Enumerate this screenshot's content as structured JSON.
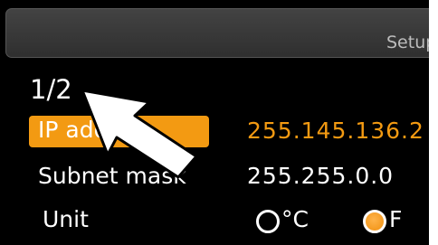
{
  "header": {
    "title": "Setup"
  },
  "page": {
    "indicator": "1/2"
  },
  "rows": {
    "ip": {
      "label": "IP address",
      "value": "255.145.136.2"
    },
    "subnet": {
      "label": "Subnet mask",
      "value": "255.255.0.0"
    },
    "unit": {
      "label": "Unit",
      "options": [
        {
          "label": "°C",
          "selected": false
        },
        {
          "label": "F",
          "selected": true
        }
      ]
    }
  },
  "colors": {
    "accent": "#f39a12",
    "background": "#000000",
    "header": "#3a3a3a"
  },
  "icons": {
    "pointer": "pointer-arrow-icon"
  }
}
